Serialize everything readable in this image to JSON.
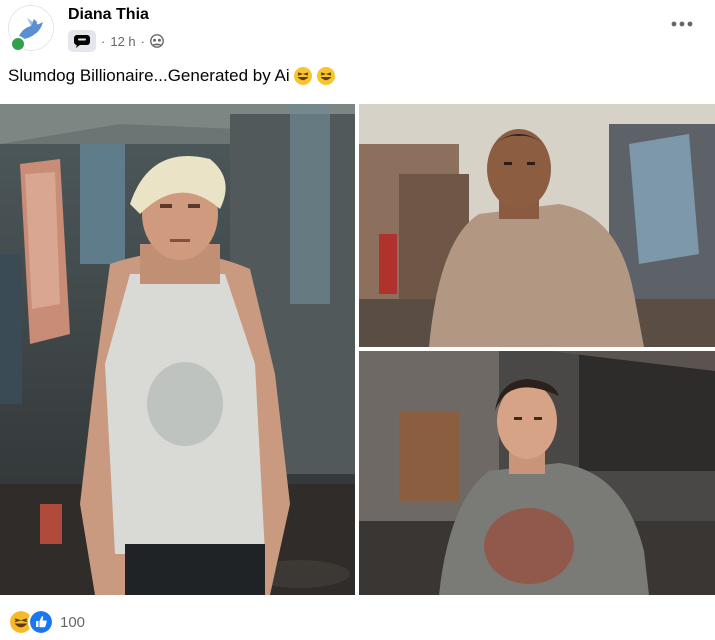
{
  "post": {
    "author": "Diana Thia",
    "time": "12 h",
    "separator": "·",
    "text": "Slumdog Billionaire...Generated by Ai",
    "emojis": [
      "laughing-emoji",
      "laughing-emoji"
    ]
  },
  "photos": [
    {
      "name": "photo-main",
      "subject": "older man in white tank top in slum"
    },
    {
      "name": "photo-top-right",
      "subject": "heavyset man in dirty t-shirt in slum"
    },
    {
      "name": "photo-bottom-right",
      "subject": "man in stained grey t-shirt in slum"
    }
  ],
  "reactions": {
    "icons": [
      "haha-reaction-icon",
      "like-reaction-icon"
    ],
    "count": "100"
  },
  "colors": {
    "text_primary": "#050505",
    "text_secondary": "#65676b",
    "like_blue": "#1877f2",
    "haha_yellow": "#f7b928",
    "online_green": "#31a24c"
  }
}
